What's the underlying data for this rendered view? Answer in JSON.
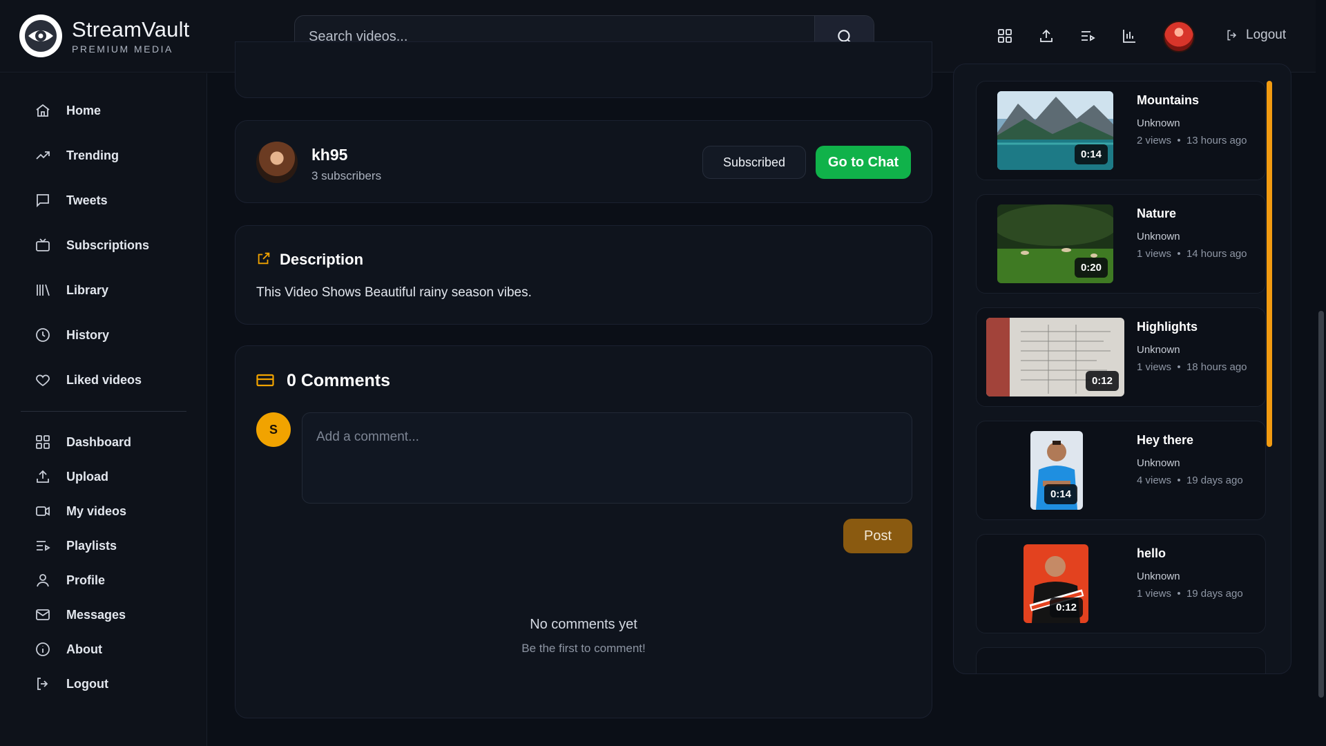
{
  "app": {
    "name": "StreamVault",
    "tagline": "PREMIUM MEDIA"
  },
  "header": {
    "search_placeholder": "Search videos...",
    "logout_label": "Logout",
    "icons": [
      "dashboard-icon",
      "upload-icon",
      "playlist-icon",
      "stats-icon"
    ]
  },
  "sidebar": {
    "primary": [
      {
        "label": "Home",
        "icon": "home-icon"
      },
      {
        "label": "Trending",
        "icon": "trending-icon"
      },
      {
        "label": "Tweets",
        "icon": "chat-bubble-icon"
      },
      {
        "label": "Subscriptions",
        "icon": "tv-icon"
      },
      {
        "label": "Library",
        "icon": "library-icon"
      },
      {
        "label": "History",
        "icon": "clock-icon"
      },
      {
        "label": "Liked videos",
        "icon": "heart-icon"
      }
    ],
    "secondary": [
      {
        "label": "Dashboard",
        "icon": "dashboard-icon"
      },
      {
        "label": "Upload",
        "icon": "upload-icon"
      },
      {
        "label": "My videos",
        "icon": "video-icon"
      },
      {
        "label": "Playlists",
        "icon": "playlist-icon"
      },
      {
        "label": "Profile",
        "icon": "user-icon"
      },
      {
        "label": "Messages",
        "icon": "mail-icon"
      },
      {
        "label": "About",
        "icon": "info-icon"
      },
      {
        "label": "Logout",
        "icon": "logout-icon"
      }
    ]
  },
  "channel": {
    "name": "kh95",
    "subscribers": "3 subscribers",
    "subscribe_label": "Subscribed",
    "chat_label": "Go to Chat"
  },
  "description": {
    "title": "Description",
    "text": "This Video Shows Beautiful rainy season vibes."
  },
  "comments": {
    "title": "0 Comments",
    "avatar_initial": "S",
    "placeholder": "Add a comment...",
    "post_label": "Post",
    "empty_title": "No comments yet",
    "empty_subtitle": "Be the first to comment!"
  },
  "related": [
    {
      "title": "Mountains",
      "author": "Unknown",
      "views": "2 views",
      "age": "13 hours ago",
      "duration": "0:14"
    },
    {
      "title": "Nature",
      "author": "Unknown",
      "views": "1 views",
      "age": "14 hours ago",
      "duration": "0:20"
    },
    {
      "title": "Highlights",
      "author": "Unknown",
      "views": "1 views",
      "age": "18 hours ago",
      "duration": "0:12"
    },
    {
      "title": "Hey there",
      "author": "Unknown",
      "views": "4 views",
      "age": "19 days ago",
      "duration": "0:14"
    },
    {
      "title": "hello",
      "author": "Unknown",
      "views": "1 views",
      "age": "19 days ago",
      "duration": "0:12"
    }
  ],
  "colors": {
    "background": "#0b0f17",
    "accent_green": "#10b24a",
    "accent_amber": "#f1a300",
    "scroll_accent": "#f29b11"
  }
}
